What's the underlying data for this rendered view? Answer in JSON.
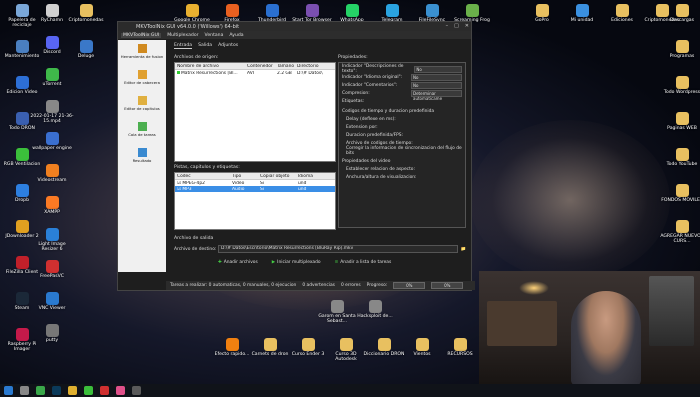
{
  "desktop_left": [
    {
      "label": "Papelera de reciclaje",
      "icon": "recycle-bin-icon",
      "color": "#7aa7d8"
    },
    {
      "label": "Mantenimiento",
      "icon": "gear-icon",
      "color": "#4a7fc0"
    },
    {
      "label": "Edicion Video",
      "icon": "video-icon",
      "color": "#2d6fd6"
    },
    {
      "label": "Todo DRON",
      "icon": "drone-icon",
      "color": "#3a5fb0"
    },
    {
      "label": "RGB Ventilacion",
      "icon": "check-icon",
      "color": "#3bbf3b"
    },
    {
      "label": "Dropb",
      "icon": "dropbox-icon",
      "color": "#2d7fe0"
    },
    {
      "label": "JDownloader 2",
      "icon": "download-icon",
      "color": "#e0a020"
    },
    {
      "label": "FileZilla Client",
      "icon": "filezilla-icon",
      "color": "#c0202a"
    },
    {
      "label": "Steam",
      "icon": "steam-icon",
      "color": "#1b2838"
    },
    {
      "label": "Raspberry Pi Imager",
      "icon": "raspberry-icon",
      "color": "#c51a4a"
    }
  ],
  "desktop_col2": [
    {
      "label": "RyChamn",
      "icon": "app-icon",
      "color": "#d0d0d0"
    },
    {
      "label": "Discord",
      "icon": "discord-icon",
      "color": "#5865f2"
    },
    {
      "label": "uTorrent",
      "icon": "torrent-icon",
      "color": "#3fb94a"
    },
    {
      "label": "2022-01-17 21-36-15.mp4",
      "icon": "video-file-icon",
      "color": "#888888"
    },
    {
      "label": "wallpaper engine",
      "icon": "wallpaper-icon",
      "color": "#3a6fd0"
    },
    {
      "label": "Videostream",
      "icon": "play-icon",
      "color": "#f08020"
    },
    {
      "label": "XAMPP",
      "icon": "xampp-icon",
      "color": "#fb7a24"
    },
    {
      "label": "Light Image Resizer 6",
      "icon": "image-icon",
      "color": "#2a80d8"
    },
    {
      "label": "FreePasVC",
      "icon": "app-icon",
      "color": "#d03030"
    },
    {
      "label": "VNC Viewer",
      "icon": "vnc-icon",
      "color": "#2a7ad0"
    },
    {
      "label": "putty",
      "icon": "putty-icon",
      "color": "#777777"
    }
  ],
  "desktop_col3": [
    {
      "label": "Criptomonedas",
      "icon": "folder-icon",
      "color": "#e8c060"
    },
    {
      "label": "Deluge",
      "icon": "deluge-icon",
      "color": "#3a78c8"
    }
  ],
  "desktop_top": [
    {
      "label": "Google Chrome",
      "icon": "chrome-icon",
      "color": "#e8b030"
    },
    {
      "label": "Firefox",
      "icon": "firefox-icon",
      "color": "#e86020"
    },
    {
      "label": "Thunderbird",
      "icon": "thunderbird-icon",
      "color": "#2a6fd0"
    },
    {
      "label": "Start Tor Browser",
      "icon": "tor-icon",
      "color": "#7a4fb0"
    },
    {
      "label": "WhatsApp",
      "icon": "whatsapp-icon",
      "color": "#25d366"
    },
    {
      "label": "Telegram",
      "icon": "telegram-icon",
      "color": "#2aa3e0"
    },
    {
      "label": "FileFileSync",
      "icon": "sync-icon",
      "color": "#3a90d0"
    },
    {
      "label": "Screaming Frog",
      "icon": "frog-icon",
      "color": "#6ab04a"
    }
  ],
  "desktop_right": [
    {
      "label": "GoPro",
      "icon": "folder-icon",
      "color": "#e8c060"
    },
    {
      "label": "Mi unidad",
      "icon": "drive-icon",
      "color": "#3a90e0"
    },
    {
      "label": "Ediciones",
      "icon": "folder-icon",
      "color": "#e8c060"
    },
    {
      "label": "Criptomonedas",
      "icon": "folder-icon",
      "color": "#e8c060"
    },
    {
      "label": "Descargas",
      "icon": "folder-icon",
      "color": "#e8c060"
    },
    {
      "label": "Programas",
      "icon": "folder-icon",
      "color": "#e8c060"
    },
    {
      "label": "Todo Wordpress",
      "icon": "folder-icon",
      "color": "#e8c060"
    },
    {
      "label": "Paginas WEB",
      "icon": "folder-icon",
      "color": "#e8c060"
    },
    {
      "label": "Todo YouTube",
      "icon": "folder-icon",
      "color": "#e8c060"
    },
    {
      "label": "FONDOS MOVILES",
      "icon": "folder-icon",
      "color": "#e8c060"
    },
    {
      "label": "AGREGAR NUEVOS CURS...",
      "icon": "folder-icon",
      "color": "#e8c060"
    }
  ],
  "desktop_bottom": [
    {
      "label": "Efecto rapido...",
      "icon": "vlc-icon",
      "color": "#f08010"
    },
    {
      "label": "Carnets de dron",
      "icon": "folder-icon",
      "color": "#e8c060"
    },
    {
      "label": "Curso Ender 3",
      "icon": "folder-icon",
      "color": "#e8c060"
    },
    {
      "label": "Curso 3D Autodesk",
      "icon": "folder-icon",
      "color": "#e8c060"
    },
    {
      "label": "Diccionario DRON",
      "icon": "folder-icon",
      "color": "#e8c060"
    },
    {
      "label": "Vientos",
      "icon": "folder-icon",
      "color": "#e8c060"
    },
    {
      "label": "RECURSOS",
      "icon": "folder-icon",
      "color": "#e8c060"
    }
  ],
  "desktop_mid": [
    {
      "label": "Garom en Santa Sebast...",
      "icon": "media-icon",
      "color": "#888888"
    },
    {
      "label": "Hacksploit de...",
      "icon": "media-icon",
      "color": "#888888"
    }
  ],
  "window": {
    "title": "MKVToolNix GUI v64.0.0 ('Willows') 64-bit",
    "menu": [
      "MKVToolNix GUI",
      "Multiplexador",
      "Ventana",
      "Ayuda"
    ],
    "sidebar": [
      "Herramienta de fusion",
      "Editor de cabecera",
      "Editor de capitulos",
      "Cola de tareas",
      "Resultado"
    ],
    "tabs": [
      "Entrada",
      "Salida",
      "Adjuntos"
    ],
    "source_label": "Archivos de origen:",
    "source_cols": [
      "Nombre de archivo",
      "Contenedor",
      "Tamano",
      "Directorio"
    ],
    "source_rows": [
      [
        "Matrix Resurrections [Bl...",
        "AVI",
        "2.2 GB",
        "D:\\# Datos\\"
      ]
    ],
    "tracks_label": "Pistas, capitulos y etiquetas:",
    "tracks_cols": [
      "Codec",
      "Tipo",
      "Copiar objeto",
      "Idioma"
    ],
    "tracks_rows": [
      [
        "MPEG-4p2",
        "Video",
        "Si",
        "und"
      ],
      [
        "MP3",
        "Audio",
        "Si",
        "und"
      ]
    ],
    "props_label": "Propiedades:",
    "props": [
      {
        "label": "Indicador \"Descripciones de texto\":",
        "value": "No"
      },
      {
        "label": "Indicador \"Idioma original\":",
        "value": "No"
      },
      {
        "label": "Indicador \"Comentarios\":",
        "value": "No"
      },
      {
        "label": "Compresion:",
        "value": "Determinar automaticame"
      },
      {
        "label": "Etiquetas:",
        "value": ""
      }
    ],
    "timing_label": "Codigos de tiempo y duracion predefinida",
    "timing": [
      "Delay (deflexe en ms):",
      "Extension por:",
      "Duracion predefinida/FPS:",
      "Archivo de codigos de tiempo:",
      "Corregir la informacion de sincronizacion del flujo de bits"
    ],
    "video_props_label": "Propiedades del video",
    "video_props": [
      "Establecer relacion de aspecto:",
      "Anchura/altura de visualizacion:"
    ],
    "output_label": "Archivo de salida",
    "output_field_label": "Archivo de destino:",
    "output_path": "D:\\# Datos\\Escritorio\\Matrix Resurrections [BluRay Rip].mkv",
    "actions": [
      "Anadir archivos",
      "Iniciar multiplexado",
      "Anadir a lista de tareas"
    ],
    "status": {
      "jobs": "Tareas a realizar: 0 automaticas, 0 manuales, 0 ejecucion",
      "warnings": "0 advertencias",
      "errors": "0 errores",
      "progress_label": "Progreso:",
      "progress1": "0%",
      "progress2": "0%"
    }
  },
  "taskbar": [
    {
      "icon": "start-icon",
      "color": "#2a7ad0"
    },
    {
      "icon": "search-icon",
      "color": "#888888"
    },
    {
      "icon": "chrome-icon",
      "color": "#3aa84a"
    },
    {
      "icon": "photoshop-icon",
      "color": "#0b3a5a"
    },
    {
      "icon": "explorer-icon",
      "color": "#e0b030"
    },
    {
      "icon": "green-app-icon",
      "color": "#3bbf3b"
    },
    {
      "icon": "red-app-icon",
      "color": "#d03030"
    },
    {
      "icon": "pink-app-icon",
      "color": "#e0508a"
    },
    {
      "icon": "recorder-icon",
      "color": "#5a5a5a"
    }
  ]
}
